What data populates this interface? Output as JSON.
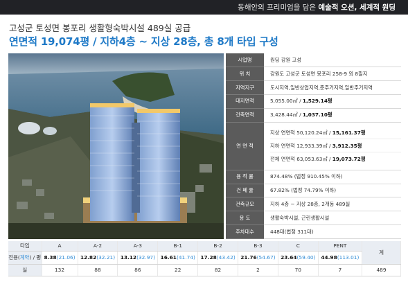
{
  "banner": {
    "prefix": "동해안의 프리미엄을 담은 ",
    "emphasis": "예술적 오션, 세계적 원딩"
  },
  "subtitle": "고성군 토성면 봉포리 생활형숙박시설 489실 공급",
  "headline": "연면적 19,074평 / 지하4층 ~ 지상 28층, 총 8개 타입 구성",
  "colors": {
    "banner": "#212226",
    "headline": "#1e79c7",
    "label_bg": "#5b5b5b",
    "area_blue": "#2f8bd6"
  },
  "specs": {
    "developer": {
      "label": "시업명",
      "value": "원딩 강원 고성"
    },
    "location": {
      "label": "위 치",
      "value": "강원도 고성군 토성면 봉포리 258-9 외 8필지"
    },
    "zoning": {
      "label": "지역지구",
      "value": "도시지역,일반상업지역,준주거지역,일반주거지역"
    },
    "site_area": {
      "label": "대지면적",
      "value": "5,055.00㎡ / ",
      "bold": "1,529.14평"
    },
    "building_area": {
      "label": "건축면적",
      "value": "3,428.44㎡ / ",
      "bold": "1,037.10평"
    },
    "floor_area": {
      "label": "연 면 적",
      "above": {
        "value": "지상 연면적 50,120.24㎡ / ",
        "bold": "15,161.37평"
      },
      "below": {
        "value": "지하 연면적 12,933.39㎡ / ",
        "bold": "3,912.35평"
      },
      "total": {
        "value": "전체 연면적 63,053.63㎡ / ",
        "bold": "19,073.72평"
      }
    },
    "far": {
      "label": "용 적 률",
      "value": "874.48% (법정 910.45% 이하)"
    },
    "bcr": {
      "label": "건 폐 율",
      "value": "67.82% (법정 74.79% 이하)"
    },
    "scale": {
      "label": "건축규모",
      "value": "지하 4층 ~ 지상 28층, 2개동 489실"
    },
    "use": {
      "label": "용 도",
      "value": "생활숙박시설, 근린생활시설"
    },
    "parking": {
      "label": "주차대수",
      "value": "448대(법정 311대)"
    }
  },
  "unit_table": {
    "type_label": "타입",
    "area_label_a": "전용(",
    "area_label_blue": "계약",
    "area_label_b": ") / 평",
    "count_label": "실",
    "total_label": "계",
    "types": [
      {
        "name": "A",
        "area": "8.38",
        "contract": "(21.06)",
        "count": "132"
      },
      {
        "name": "A-2",
        "area": "12.82",
        "contract": "(32.21)",
        "count": "88"
      },
      {
        "name": "A-3",
        "area": "13.12",
        "contract": "(32.97)",
        "count": "86"
      },
      {
        "name": "B-1",
        "area": "16.61",
        "contract": "(41.74)",
        "count": "22"
      },
      {
        "name": "B-2",
        "area": "17.28",
        "contract": "(43.42)",
        "count": "82"
      },
      {
        "name": "B-3",
        "area": "21.76",
        "contract": "(54.67)",
        "count": "2"
      },
      {
        "name": "C",
        "area": "23.64",
        "contract": "(59.40)",
        "count": "70"
      },
      {
        "name": "PENT",
        "area": "44.98",
        "contract": "(113.01)",
        "count": "7"
      }
    ],
    "total_count": "489"
  }
}
